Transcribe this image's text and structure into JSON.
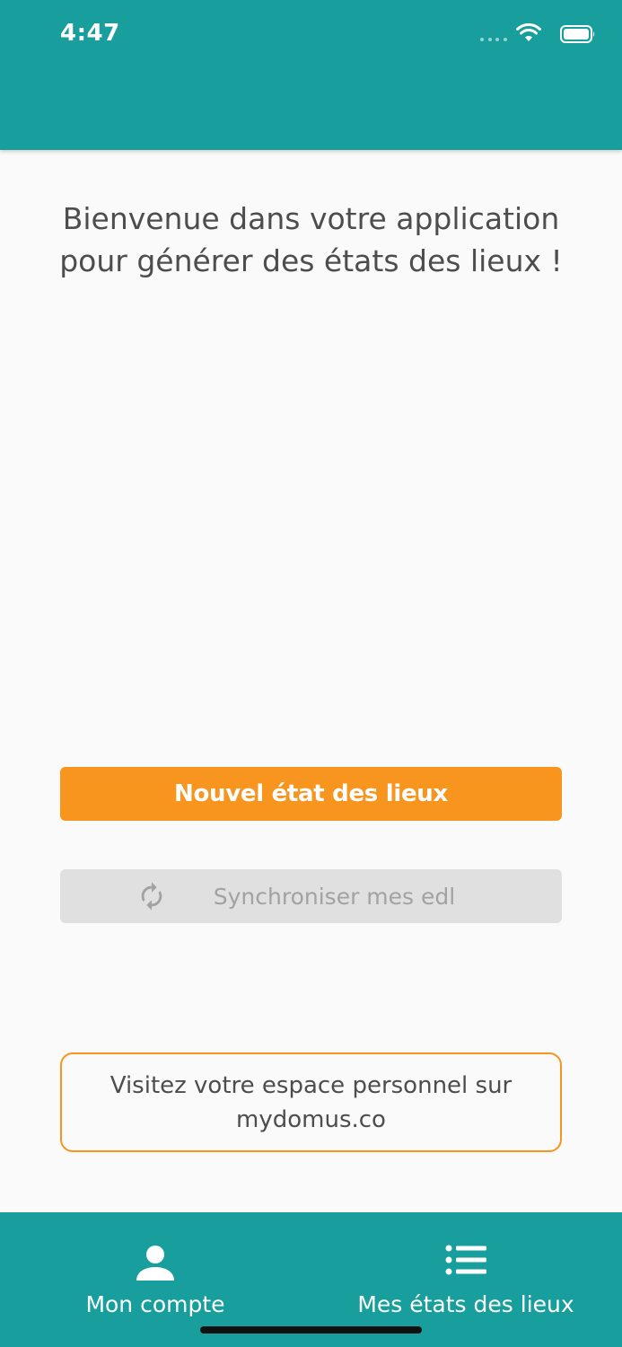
{
  "status_bar": {
    "time": "4:47",
    "wifi_icon": "wifi-icon",
    "battery_icon": "battery-icon"
  },
  "colors": {
    "teal": "#189e9c",
    "orange": "#f7951f",
    "gray_button": "#e0e0e0",
    "gray_text": "#a2a2a2",
    "body_text": "#4d4d4d",
    "background": "#fafafa"
  },
  "main": {
    "welcome_line1": "Bienvenue dans votre application",
    "welcome_line2": "pour générer des états des lieux !",
    "new_button_label": "Nouvel état des lieux",
    "sync_button_label": "Synchroniser mes edl",
    "sync_icon": "refresh-icon",
    "visit_line1": "Visitez votre espace personnel sur",
    "visit_line2": "mydomus.co"
  },
  "tabbar": {
    "tabs": [
      {
        "label": "Mon compte",
        "icon": "user-icon"
      },
      {
        "label": "Mes états des lieux",
        "icon": "list-icon"
      }
    ]
  }
}
